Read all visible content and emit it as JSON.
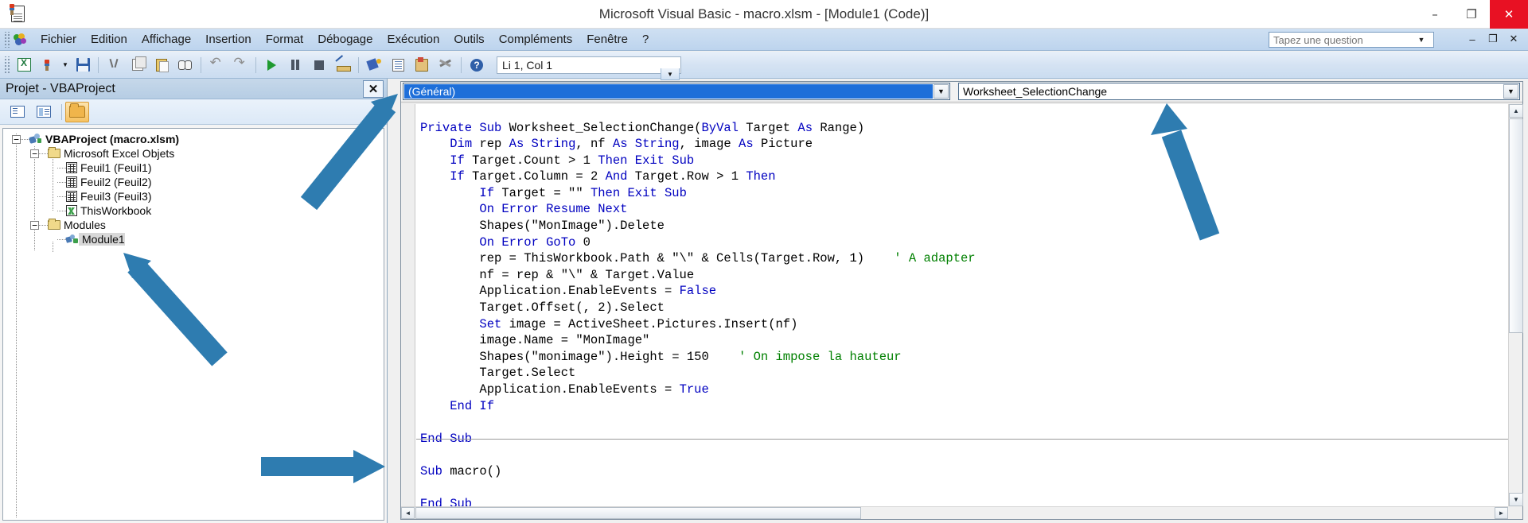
{
  "window": {
    "title": "Microsoft Visual Basic - macro.xlsm - [Module1 (Code)]",
    "minimize_label": "–",
    "restore_label": "❐",
    "close_label": "✕"
  },
  "menubar": {
    "items": [
      {
        "label": "Fichier"
      },
      {
        "label": "Edition"
      },
      {
        "label": "Affichage"
      },
      {
        "label": "Insertion"
      },
      {
        "label": "Format"
      },
      {
        "label": "Débogage"
      },
      {
        "label": "Exécution"
      },
      {
        "label": "Outils"
      },
      {
        "label": "Compléments"
      },
      {
        "label": "Fenêtre"
      },
      {
        "label": "?"
      }
    ],
    "question_placeholder": "Tapez une question",
    "question_value": "",
    "mdi_minimize": "–",
    "mdi_restore": "❐",
    "mdi_close": "✕"
  },
  "toolbar": {
    "position_value": "Li 1, Col 1",
    "icons": [
      "view-excel-icon",
      "insert-userform-icon",
      "save-icon",
      "cut-icon",
      "copy-icon",
      "paste-icon",
      "find-icon",
      "undo-icon",
      "redo-icon",
      "run-icon",
      "break-icon",
      "reset-icon",
      "design-mode-icon",
      "project-explorer-icon",
      "properties-window-icon",
      "object-browser-icon",
      "toolbox-icon",
      "help-icon"
    ],
    "dropdown_caret": "▼"
  },
  "project_explorer": {
    "title": "Projet - VBAProject",
    "close_label": "✕",
    "toolbar": {
      "view_code_label": "view-code-icon",
      "view_object_label": "view-object-icon",
      "toggle_folders_label": "toggle-folders-icon"
    },
    "tree": [
      {
        "label": "VBAProject (macro.xlsm)",
        "level": 0,
        "icon": "vbaproject-icon",
        "expander": "−",
        "bold": true,
        "selected": false
      },
      {
        "label": "Microsoft Excel Objets",
        "level": 1,
        "icon": "folder-icon",
        "expander": "−",
        "bold": false,
        "selected": false
      },
      {
        "label": "Feuil1 (Feuil1)",
        "level": 2,
        "icon": "worksheet-icon",
        "expander": "",
        "bold": false,
        "selected": false
      },
      {
        "label": "Feuil2 (Feuil2)",
        "level": 2,
        "icon": "worksheet-icon",
        "expander": "",
        "bold": false,
        "selected": false
      },
      {
        "label": "Feuil3 (Feuil3)",
        "level": 2,
        "icon": "worksheet-icon",
        "expander": "",
        "bold": false,
        "selected": false
      },
      {
        "label": "ThisWorkbook",
        "level": 2,
        "icon": "workbook-icon",
        "expander": "",
        "bold": false,
        "selected": false
      },
      {
        "label": "Modules",
        "level": 1,
        "icon": "folder-icon",
        "expander": "−",
        "bold": false,
        "selected": false
      },
      {
        "label": "Module1",
        "level": 2,
        "icon": "module-icon",
        "expander": "",
        "bold": false,
        "selected": true
      }
    ]
  },
  "code_window": {
    "object_combo": {
      "value": "(Général)",
      "caret": "▼"
    },
    "procedure_combo": {
      "value": "Worksheet_SelectionChange",
      "caret": "▼"
    },
    "lines": [
      {
        "segments": [
          {
            "t": "Private Sub ",
            "c": "kw"
          },
          {
            "t": "Worksheet_SelectionChange(",
            "c": ""
          },
          {
            "t": "ByVal ",
            "c": "kw"
          },
          {
            "t": "Target ",
            "c": ""
          },
          {
            "t": "As ",
            "c": "kw"
          },
          {
            "t": "Range)",
            "c": ""
          }
        ]
      },
      {
        "segments": [
          {
            "t": "    ",
            "c": ""
          },
          {
            "t": "Dim ",
            "c": "kw"
          },
          {
            "t": "rep ",
            "c": ""
          },
          {
            "t": "As String",
            "c": "kw"
          },
          {
            "t": ", nf ",
            "c": ""
          },
          {
            "t": "As String",
            "c": "kw"
          },
          {
            "t": ", image ",
            "c": ""
          },
          {
            "t": "As ",
            "c": "kw"
          },
          {
            "t": "Picture",
            "c": ""
          }
        ]
      },
      {
        "segments": [
          {
            "t": "    ",
            "c": ""
          },
          {
            "t": "If ",
            "c": "kw"
          },
          {
            "t": "Target.Count > 1 ",
            "c": ""
          },
          {
            "t": "Then Exit Sub",
            "c": "kw"
          }
        ]
      },
      {
        "segments": [
          {
            "t": "    ",
            "c": ""
          },
          {
            "t": "If ",
            "c": "kw"
          },
          {
            "t": "Target.Column = 2 ",
            "c": ""
          },
          {
            "t": "And ",
            "c": "kw"
          },
          {
            "t": "Target.Row > 1 ",
            "c": ""
          },
          {
            "t": "Then",
            "c": "kw"
          }
        ]
      },
      {
        "segments": [
          {
            "t": "        ",
            "c": ""
          },
          {
            "t": "If ",
            "c": "kw"
          },
          {
            "t": "Target = \"\" ",
            "c": ""
          },
          {
            "t": "Then Exit Sub",
            "c": "kw"
          }
        ]
      },
      {
        "segments": [
          {
            "t": "        ",
            "c": ""
          },
          {
            "t": "On Error Resume Next",
            "c": "kw"
          }
        ]
      },
      {
        "segments": [
          {
            "t": "        Shapes(\"MonImage\").Delete",
            "c": ""
          }
        ]
      },
      {
        "segments": [
          {
            "t": "        ",
            "c": ""
          },
          {
            "t": "On Error GoTo ",
            "c": "kw"
          },
          {
            "t": "0",
            "c": ""
          }
        ]
      },
      {
        "segments": [
          {
            "t": "        rep = ThisWorkbook.Path & \"\\\" & Cells(Target.Row, 1)    ",
            "c": ""
          },
          {
            "t": "' A adapter",
            "c": "cm"
          }
        ]
      },
      {
        "segments": [
          {
            "t": "        nf = rep & \"\\\" & Target.Value",
            "c": ""
          }
        ]
      },
      {
        "segments": [
          {
            "t": "        Application.EnableEvents = ",
            "c": ""
          },
          {
            "t": "False",
            "c": "kw"
          }
        ]
      },
      {
        "segments": [
          {
            "t": "        Target.Offset(, 2).Select",
            "c": ""
          }
        ]
      },
      {
        "segments": [
          {
            "t": "        ",
            "c": ""
          },
          {
            "t": "Set ",
            "c": "kw"
          },
          {
            "t": "image = ActiveSheet.Pictures.Insert(nf)",
            "c": ""
          }
        ]
      },
      {
        "segments": [
          {
            "t": "        image.Name = \"MonImage\"",
            "c": ""
          }
        ]
      },
      {
        "segments": [
          {
            "t": "        Shapes(\"monimage\").Height = 150    ",
            "c": ""
          },
          {
            "t": "' On impose la hauteur",
            "c": "cm"
          }
        ]
      },
      {
        "segments": [
          {
            "t": "        Target.Select",
            "c": ""
          }
        ]
      },
      {
        "segments": [
          {
            "t": "        Application.EnableEvents = ",
            "c": ""
          },
          {
            "t": "True",
            "c": "kw"
          }
        ]
      },
      {
        "segments": [
          {
            "t": "    ",
            "c": ""
          },
          {
            "t": "End If",
            "c": "kw"
          }
        ]
      },
      {
        "segments": [
          {
            "t": "",
            "c": ""
          }
        ]
      },
      {
        "segments": [
          {
            "t": "End Sub",
            "c": "kw"
          }
        ]
      }
    ],
    "lines2": [
      {
        "segments": [
          {
            "t": "",
            "c": ""
          }
        ]
      },
      {
        "segments": [
          {
            "t": "Sub ",
            "c": "kw"
          },
          {
            "t": "macro()",
            "c": ""
          }
        ]
      },
      {
        "segments": [
          {
            "t": "",
            "c": ""
          }
        ]
      },
      {
        "segments": [
          {
            "t": "End Sub",
            "c": "kw"
          }
        ]
      }
    ],
    "scrollbar": {
      "up_arrow": "▲",
      "down_arrow": "▼",
      "left_arrow": "◄",
      "right_arrow": "►"
    }
  },
  "annotations": {
    "color": "#2E7CB0",
    "arrows": [
      {
        "name": "arrow-to-object-combo",
        "target": "object-combo"
      },
      {
        "name": "arrow-to-module1",
        "target": "module1-tree-node"
      },
      {
        "name": "arrow-to-empty-code-line",
        "target": "code-blank-area"
      },
      {
        "name": "arrow-to-procedure-combo",
        "target": "procedure-combo"
      }
    ]
  }
}
